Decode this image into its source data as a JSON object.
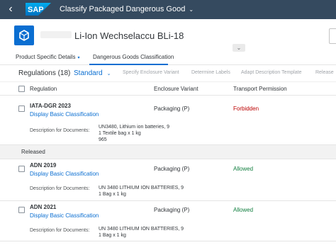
{
  "shell": {
    "back_icon": "back-chevron-icon",
    "logo_text": "SAP",
    "title": "Classify Packaged Dangerous Good",
    "title_icon": "chevron-down-icon"
  },
  "object": {
    "icon": "product-box-icon",
    "title": "Li-Ion Wechselaccu BLi-18"
  },
  "anchors": [
    {
      "label": "Product Specific Details",
      "icon": "chevron-down-icon"
    },
    {
      "label": "Dangerous Goods Classification"
    }
  ],
  "toolbar": {
    "count_label": "Regulations (18)",
    "variant_label": "Standard",
    "actions": [
      "Specify Enclosure Variant",
      "Determine Labels",
      "Adapt Description Template",
      "Release"
    ]
  },
  "columns": {
    "regulation": "Regulation",
    "enclosure": "Enclosure Variant",
    "transport": "Transport Permission"
  },
  "rows": [
    {
      "code": "IATA-DGR 2023",
      "link": "Display Basic Classification",
      "desc_label": "Description for Documents:",
      "desc_lines": [
        "UN3480, Lithium ion batteries, 9",
        "1 Textile bag x 1 kg",
        "965"
      ],
      "enclosure": "Packaging (P)",
      "permission": "Forbidden"
    },
    {
      "code": "ADN 2019",
      "link": "Display Basic Classification",
      "desc_label": "Description for Documents:",
      "desc_lines": [
        "UN 3480 LITHIUM ION BATTERIES, 9",
        "1 Bag x 1 kg"
      ],
      "enclosure": "Packaging (P)",
      "permission": "Allowed"
    },
    {
      "code": "ADN 2021",
      "link": "Display Basic Classification",
      "desc_label": "Description for Documents:",
      "desc_lines": [
        "UN 3480 LITHIUM ION BATTERIES, 9",
        "1 Bag x 1 kg"
      ],
      "enclosure": "Packaging (P)",
      "permission": "Allowed"
    }
  ],
  "group_label": "Released",
  "colors": {
    "shell": "#354a5f",
    "accent": "#0a6ed1",
    "forbidden": "#bb0000",
    "allowed": "#107e3e"
  }
}
